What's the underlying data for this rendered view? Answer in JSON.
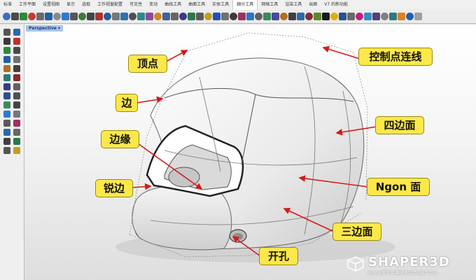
{
  "tabs": [
    "标准",
    "工作平面",
    "设置视图",
    "显示",
    "选取",
    "工作视窗配置",
    "可见性",
    "变动",
    "曲线工具",
    "曲面工具",
    "实体工具",
    "细分工具",
    "网格工具",
    "渲染工具",
    "出图",
    "V7 的新功能"
  ],
  "active_tab_index": 11,
  "viewport": {
    "label": "Perspective"
  },
  "callouts": {
    "vertex": "顶点",
    "control_point_line": "控制点连线",
    "edge": "边",
    "four_sided_face": "四边面",
    "boundary": "边缘",
    "sharp_edge": "锐边",
    "ngon_face": "Ngon 面",
    "triangle_face": "三边面",
    "hole": "开孔"
  },
  "logo": {
    "name": "SHAPER3D",
    "sub": "Rhino[犀牛]中国技术支持&推广中心"
  },
  "colors": {
    "callout_bg": "#fde84a",
    "arrow": "#d81818"
  }
}
